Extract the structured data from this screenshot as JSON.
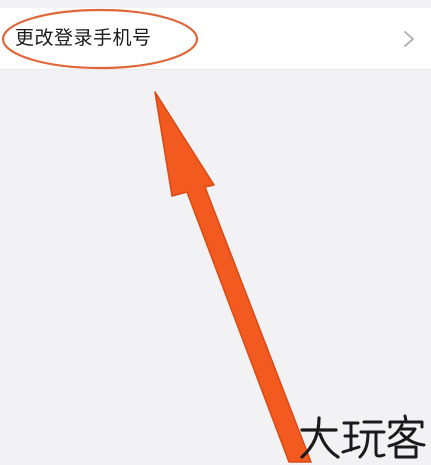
{
  "settings": {
    "change_phone_label": "更改登录手机号",
    "chevron_icon": "chevron-right-icon"
  },
  "annotations": {
    "highlight_color": "#e0663a",
    "arrow_color": "#f25a1f",
    "arrow_outline_color": "#d94a14"
  },
  "watermark": {
    "text": "大玩客"
  },
  "colors": {
    "background": "#f2f1f3",
    "row_background": "#ffffff",
    "text": "#1a1a1a",
    "chevron": "#b5b5b8"
  }
}
